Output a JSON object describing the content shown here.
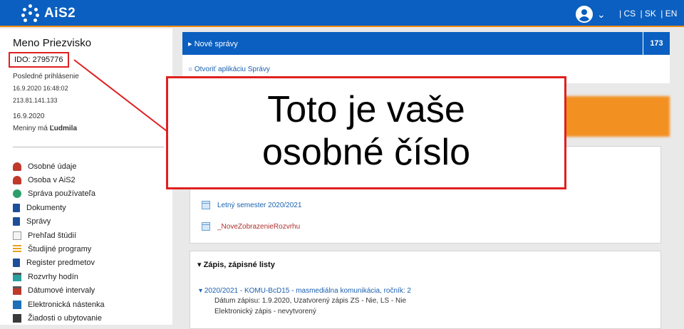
{
  "header": {
    "logo_text": "AiS2",
    "languages": [
      "| CS",
      "| SK",
      "| EN"
    ]
  },
  "user": {
    "name": "Meno Priezvisko",
    "ido": "IDO: 2795776",
    "last_login_label": "Posledné prihlásenie",
    "last_login_time": "16.9.2020 16:48:02",
    "last_login_ip": "213.81.141.133",
    "today": "16.9.2020",
    "nameday_prefix": "Meniny má ",
    "nameday_name": "Ľudmila"
  },
  "menu": [
    {
      "label": "Osobné údaje",
      "icon": "person-icon",
      "color": "#c0392b"
    },
    {
      "label": "Osoba v AiS2",
      "icon": "person-icon",
      "color": "#c0392b"
    },
    {
      "label": "Správa používateľa",
      "icon": "users-icon",
      "color": "#2e9e6a"
    },
    {
      "label": "Dokumenty",
      "icon": "book-icon",
      "color": "#1d4e9a"
    },
    {
      "label": "Správy",
      "icon": "book-icon",
      "color": "#1d4e9a"
    },
    {
      "label": "Prehľad štúdií",
      "icon": "document-icon",
      "color": "#d4d4d4"
    },
    {
      "label": "Študijné programy",
      "icon": "list-icon",
      "color": "#e8a020"
    },
    {
      "label": "Register predmetov",
      "icon": "book-icon",
      "color": "#1d4e9a"
    },
    {
      "label": "Rozvrhy hodín",
      "icon": "calendar-icon",
      "color": "#2aa0a0"
    },
    {
      "label": "Dátumové intervaly",
      "icon": "calendar-icon",
      "color": "#c0392b"
    },
    {
      "label": "Elektronická nástenka",
      "icon": "board-icon",
      "color": "#1d6fb8"
    },
    {
      "label": "Žiadosti o ubytovanie",
      "icon": "building-icon",
      "color": "#3a3a3a"
    }
  ],
  "news": {
    "label": "Nové správy",
    "count": "173",
    "link": "Otvoriť aplikáciu Správy"
  },
  "semesters": {
    "s1": "Letný semester 2020/2021",
    "s2": "_NoveZobrazenieRozvrhu"
  },
  "enrollment": {
    "title": "Zápis, zápisné listy",
    "link": "2020/2021 - KOMU-BcD15 - masmediálna komunikácia, ročník: 2",
    "detail1": "Dátum zápisu: 1.9.2020, Uzatvorený zápis ZS - Nie, LS - Nie",
    "detail2": "Elektronický zápis - nevytvorený"
  },
  "overlay": {
    "line1": "Toto je vaše",
    "line2": "osobné číslo"
  },
  "colors": {
    "header_blue": "#0a5fc0",
    "accent_orange": "#f39022",
    "highlight_red": "#e02020",
    "link_blue": "#1a60b0",
    "link_red": "#b03030"
  }
}
